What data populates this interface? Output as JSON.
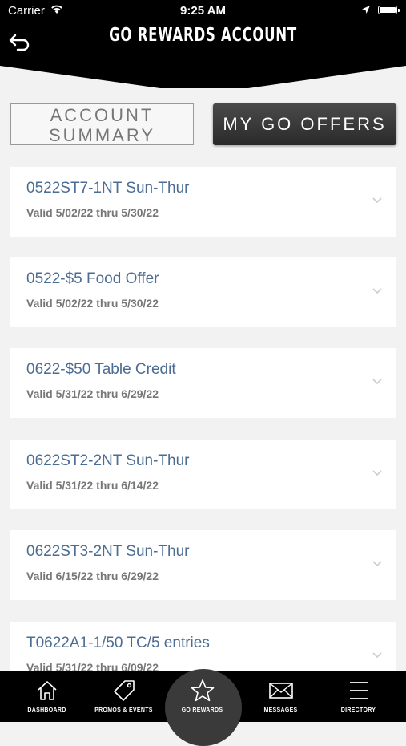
{
  "status_bar": {
    "carrier": "Carrier",
    "time": "9:25 AM"
  },
  "header": {
    "title": "GO REWARDS ACCOUNT"
  },
  "segments": {
    "summary_line1": "ACCOUNT",
    "summary_line2": "SUMMARY",
    "offers": "MY GO OFFERS"
  },
  "offers": [
    {
      "name": "0522ST7-1NT Sun-Thur",
      "valid": "Valid 5/02/22 thru 5/30/22"
    },
    {
      "name": "0522-$5 Food Offer",
      "valid": "Valid 5/02/22 thru 5/30/22"
    },
    {
      "name": "0622-$50 Table Credit",
      "valid": "Valid 5/31/22 thru 6/29/22"
    },
    {
      "name": "0622ST2-2NT Sun-Thur",
      "valid": "Valid 5/31/22 thru 6/14/22"
    },
    {
      "name": "0622ST3-2NT Sun-Thur",
      "valid": "Valid 6/15/22 thru 6/29/22"
    },
    {
      "name": "T0622A1-1/50 TC/5 entries",
      "valid": "Valid 5/31/22 thru 6/09/22"
    }
  ],
  "tabs": [
    {
      "label": "DASHBOARD",
      "icon": "home-icon"
    },
    {
      "label": "PROMOS & EVENTS",
      "icon": "tag-icon"
    },
    {
      "label": "GO REWARDS",
      "icon": "star-icon",
      "active": true
    },
    {
      "label": "MESSAGES",
      "icon": "envelope-icon"
    },
    {
      "label": "DIRECTORY",
      "icon": "menu-icon"
    }
  ]
}
